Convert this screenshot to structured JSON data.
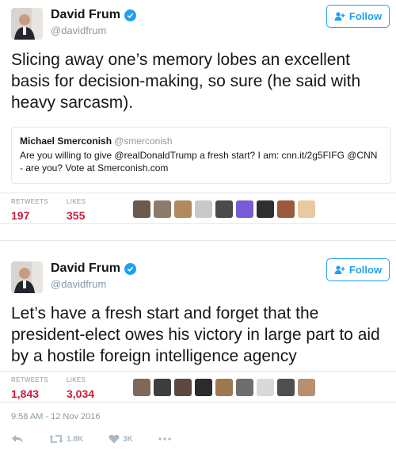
{
  "tweets": [
    {
      "author": {
        "name": "David Frum",
        "handle": "@davidfrum"
      },
      "follow_label": "Follow",
      "text": "Slicing away one’s memory lobes an excellent basis for decision-making, so sure (he said with heavy sarcasm).",
      "quote": {
        "name": "Michael Smerconish",
        "handle": "@smerconish",
        "text": "Are you willing to give @realDonaldTrump a fresh start? I am: cnn.it/2g5FIFG @CNN - are you? Vote at Smerconish.com"
      },
      "stats": {
        "retweets_label": "RETWEETS",
        "retweets": "197",
        "likes_label": "LIKES",
        "likes": "355"
      },
      "liker_colors": [
        "#6b5a4e",
        "#8c7b6b",
        "#b08a5c",
        "#c9c9c9",
        "#4a4a4a",
        "#7a5bd6",
        "#2f2f2f",
        "#9b5a3c",
        "#e8c9a0"
      ]
    },
    {
      "author": {
        "name": "David Frum",
        "handle": "@davidfrum"
      },
      "follow_label": "Follow",
      "text": "Let’s have a fresh start and forget that the president-elect owes his victory in large part to aid by a hostile foreign intelligence agency",
      "stats": {
        "retweets_label": "RETWEETS",
        "retweets": "1,843",
        "likes_label": "LIKES",
        "likes": "3,034"
      },
      "liker_colors": [
        "#7d6a5c",
        "#3d3d3d",
        "#5c4a3e",
        "#2b2b2b",
        "#a07850",
        "#6e6e6e",
        "#d9d9d9",
        "#4f4f4f",
        "#b89070"
      ],
      "timestamp": "9:58 AM - 12 Nov 2016",
      "actions": {
        "retweet_count": "1.8K",
        "like_count": "3K"
      }
    }
  ],
  "colors": {
    "accent": "#1da1f2",
    "stat_value": "#cc1c3a",
    "muted": "#8899a6"
  }
}
